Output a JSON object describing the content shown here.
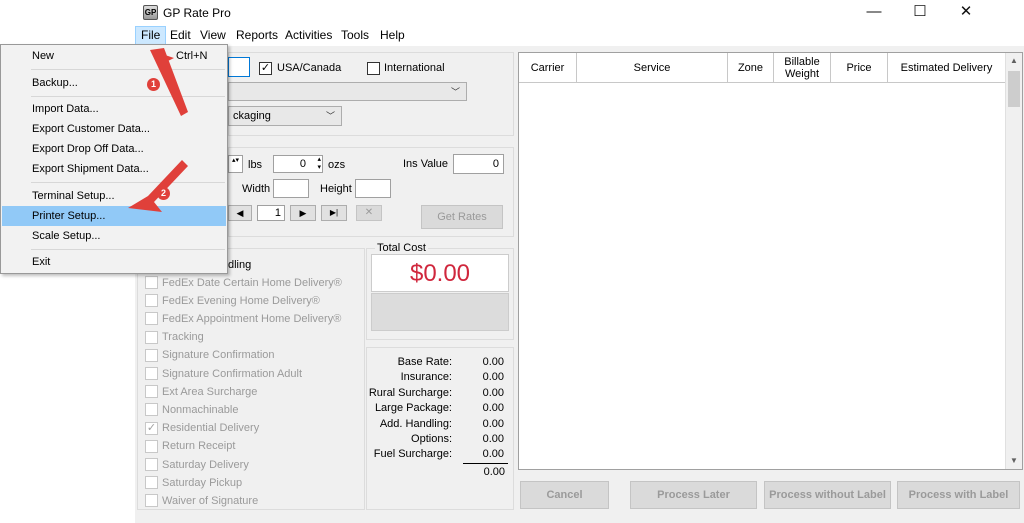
{
  "window": {
    "title": "GP Rate Pro",
    "app_icon": "GP",
    "min_glyph": "—",
    "max_glyph": "☐",
    "close_glyph": "✕"
  },
  "menubar": {
    "file": "File",
    "edit": "Edit",
    "view": "View",
    "reports": "Reports",
    "activities": "Activities",
    "tools": "Tools",
    "help": "Help"
  },
  "file_menu": {
    "new": "New",
    "new_shortcut": "Ctrl+N",
    "backup": "Backup...",
    "import": "Import Data...",
    "export_customer": "Export Customer Data...",
    "export_dropoff": "Export Drop Off Data...",
    "export_shipment": "Export Shipment Data...",
    "terminal": "Terminal Setup...",
    "printer": "Printer Setup...",
    "scale": "Scale Setup...",
    "exit": "Exit"
  },
  "destination": {
    "usa_canada": "USA/Canada",
    "usa_canada_checked": true,
    "international": "International",
    "international_checked": false
  },
  "packaging": {
    "value": "ckaging"
  },
  "weight": {
    "lbs_label": "lbs",
    "ozs_value": "0",
    "ozs_label": "ozs",
    "ins_label": "Ins Value",
    "ins_value": "0"
  },
  "dims": {
    "width_label": "Width",
    "height_label": "Height"
  },
  "pager": {
    "page": "1",
    "prev_glyph": "◀",
    "next_glyph": "▶",
    "last_glyph": "▶|",
    "clear_glyph": "✕"
  },
  "get_rates": "Get Rates",
  "options": {
    "partial_header": "dling",
    "items": [
      {
        "label": "FedEx Date Certain Home Delivery®",
        "checked": false
      },
      {
        "label": "FedEx Evening Home Delivery®",
        "checked": false
      },
      {
        "label": "FedEx Appointment Home Delivery®",
        "checked": false
      },
      {
        "label": "Tracking",
        "checked": false
      },
      {
        "label": "Signature Confirmation",
        "checked": false
      },
      {
        "label": "Signature Confirmation Adult",
        "checked": false
      },
      {
        "label": "Ext Area Surcharge",
        "checked": false
      },
      {
        "label": "Nonmachinable",
        "checked": false
      },
      {
        "label": "Residential Delivery",
        "checked": true
      },
      {
        "label": "Return Receipt",
        "checked": false
      },
      {
        "label": "Saturday Delivery",
        "checked": false
      },
      {
        "label": "Saturday Pickup",
        "checked": false
      },
      {
        "label": "Waiver of Signature",
        "checked": false
      }
    ]
  },
  "cost": {
    "label": "Total Cost",
    "value": "$0.00",
    "color": "#d0273d",
    "rows": [
      {
        "label": "Base Rate:",
        "value": "0.00"
      },
      {
        "label": "Insurance:",
        "value": "0.00"
      },
      {
        "label": "Rural Surcharge:",
        "value": "0.00"
      },
      {
        "label": "Large Package:",
        "value": "0.00"
      },
      {
        "label": "Add. Handling:",
        "value": "0.00"
      },
      {
        "label": "Options:",
        "value": "0.00"
      },
      {
        "label": "Fuel Surcharge:",
        "value": "0.00"
      }
    ],
    "total": "0.00"
  },
  "grid": {
    "columns": [
      "Carrier",
      "Service",
      "Zone",
      "Billable Weight",
      "Price",
      "Estimated Delivery"
    ]
  },
  "actions": {
    "cancel": "Cancel",
    "later": "Process Later",
    "without_label": "Process without Label",
    "with_label": "Process with Label"
  },
  "callouts": {
    "one": "1",
    "two": "2",
    "color": "#e0403a"
  }
}
